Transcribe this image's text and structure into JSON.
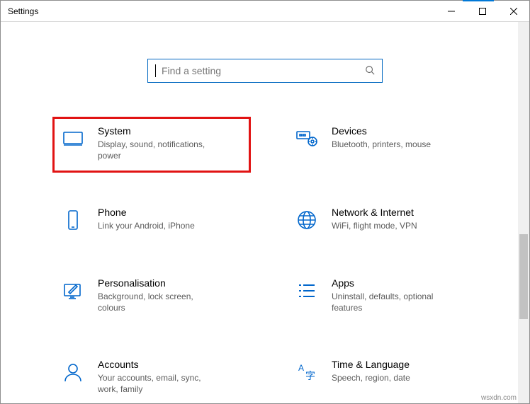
{
  "window": {
    "title": "Settings"
  },
  "search": {
    "placeholder": "Find a setting"
  },
  "tiles": {
    "system": {
      "title": "System",
      "desc": "Display, sound, notifications, power"
    },
    "devices": {
      "title": "Devices",
      "desc": "Bluetooth, printers, mouse"
    },
    "phone": {
      "title": "Phone",
      "desc": "Link your Android, iPhone"
    },
    "network": {
      "title": "Network & Internet",
      "desc": "WiFi, flight mode, VPN"
    },
    "personal": {
      "title": "Personalisation",
      "desc": "Background, lock screen, colours"
    },
    "apps": {
      "title": "Apps",
      "desc": "Uninstall, defaults, optional features"
    },
    "accounts": {
      "title": "Accounts",
      "desc": "Your accounts, email, sync, work, family"
    },
    "timelang": {
      "title": "Time & Language",
      "desc": "Speech, region, date"
    }
  },
  "watermark": "wsxdn.com"
}
